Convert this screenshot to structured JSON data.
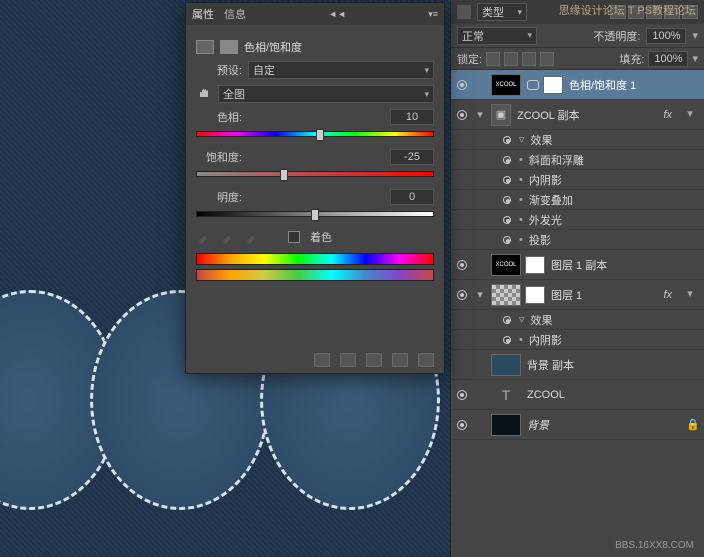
{
  "watermark": {
    "top": "思缘设计论坛  T PS教程论坛",
    "bottom": "BBS.16XX8.COM"
  },
  "props": {
    "tab_properties": "属性",
    "tab_info": "信息",
    "adj_name": "色相/饱和度",
    "preset_label": "预设:",
    "preset_value": "自定",
    "range_value": "全图",
    "hue_label": "色相:",
    "hue_value": "10",
    "sat_label": "饱和度:",
    "sat_value": "-25",
    "light_label": "明度:",
    "light_value": "0",
    "colorize_label": "着色"
  },
  "layers": {
    "kind_label": "类型",
    "blend_mode": "正常",
    "opacity_label": "不透明度:",
    "opacity_value": "100%",
    "lock_label": "锁定:",
    "fill_label": "填充:",
    "fill_value": "100%",
    "items": [
      {
        "name": "色相/饱和度 1",
        "selected": true,
        "thumb": "text",
        "thumb_text": "XCOOL",
        "mask": true,
        "link": true
      },
      {
        "name": "ZCOOL 副本",
        "fx": true,
        "disc": "▾",
        "smart": true
      },
      {
        "sub": "效果",
        "disc": "▾"
      },
      {
        "sub": "斜面和浮雕"
      },
      {
        "sub": "内阴影"
      },
      {
        "sub": "渐变叠加"
      },
      {
        "sub": "外发光"
      },
      {
        "sub": "投影"
      },
      {
        "name": "图层 1 副本",
        "thumb": "text",
        "thumb_text": "XCOOL",
        "mask": true
      },
      {
        "name": "图层 1",
        "thumb": "checker",
        "mask": true,
        "fx": true,
        "disc": "▾"
      },
      {
        "sub": "效果",
        "disc": "▾"
      },
      {
        "sub": "内阴影"
      },
      {
        "name": "背景 副本",
        "thumb": "denim",
        "no_eye": true
      },
      {
        "name": "ZCOOL",
        "thumb": "t",
        "thumb_text": "T"
      },
      {
        "name": "背景",
        "thumb": "dark",
        "italic": true,
        "locked": true
      }
    ]
  }
}
